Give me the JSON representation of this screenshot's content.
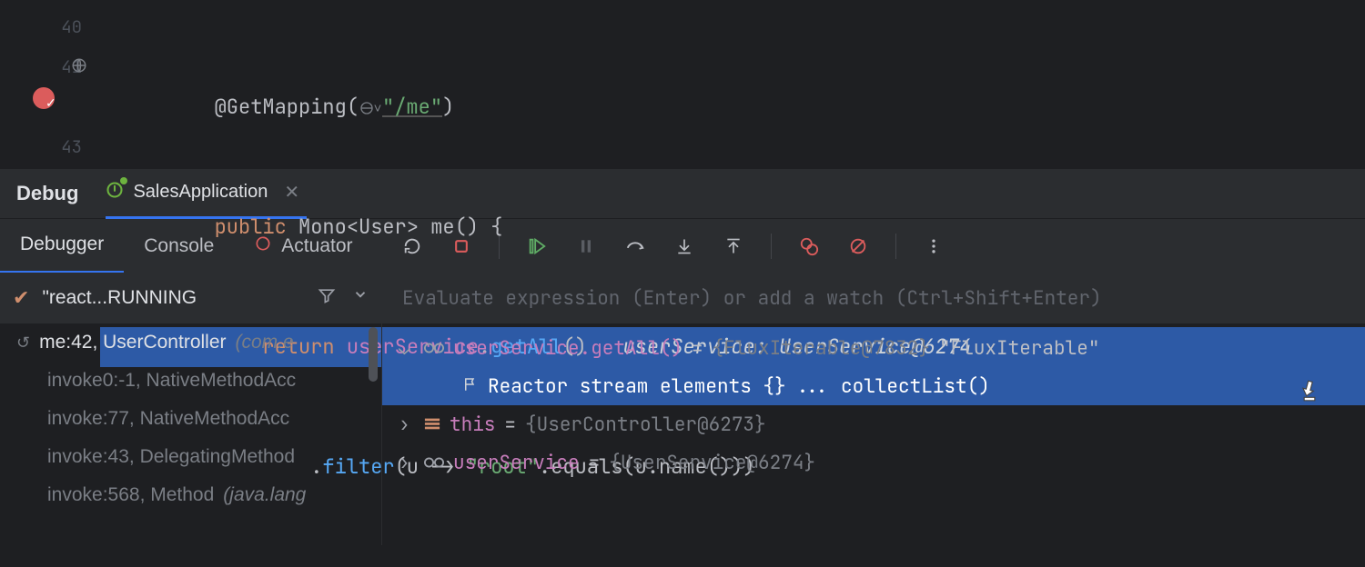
{
  "editor": {
    "lines": {
      "l40": {
        "no": "40",
        "annotation": "@GetMapping",
        "url": "\"/me\"",
        "paren_open": "(",
        "paren_close": ")"
      },
      "l41": {
        "no": "41",
        "kw_public": "public",
        "type": "Mono<User>",
        "method": "me",
        "tail": "() {"
      },
      "l42": {
        "no": "",
        "kw_return": "return",
        "ident": "userService",
        "dot": ".",
        "call": "getAll",
        "parens": "()",
        "inlay": "userService: UserService@6274"
      },
      "l43": {
        "no": "43",
        "indent": "                ",
        "dot": ".",
        "call": "filter",
        "args_pre": "(u -> ",
        "str": "\"root\"",
        "args_post": ".equals(u.name()))"
      }
    }
  },
  "debug_header": {
    "title": "Debug",
    "run_config": "SalesApplication"
  },
  "debug_tabs": {
    "debugger": "Debugger",
    "console": "Console",
    "actuator": "Actuator"
  },
  "frames": {
    "thread": "\"react...RUNNING",
    "rows": [
      {
        "undo": true,
        "main": "me:42, UserController ",
        "dim": "(com.e"
      },
      {
        "undo": false,
        "main": "invoke0:-1, NativeMethodAcc",
        "dim": ""
      },
      {
        "undo": false,
        "main": "invoke:77, NativeMethodAcc",
        "dim": ""
      },
      {
        "undo": false,
        "main": "invoke:43, DelegatingMethod",
        "dim": ""
      },
      {
        "undo": false,
        "main": "invoke:568, Method ",
        "dim": "(java.lang"
      }
    ]
  },
  "vars": {
    "eval_placeholder": "Evaluate expression (Enter) or add a watch (Ctrl+Shift+Enter)",
    "rows": [
      {
        "kind": "watch",
        "chev": "⌄",
        "name": "userService.getAll()",
        "eq": " = ",
        "obj": "{FluxIterable@7832}",
        "str": " \"FluxIterable\""
      },
      {
        "kind": "reactor",
        "indent": 1,
        "selected": true,
        "label": "Reactor stream elements {}",
        "hint": " ... collectList()"
      },
      {
        "kind": "var",
        "chev": "›",
        "icon": "field",
        "name": "this",
        "eq": " = ",
        "obj": "{UserController@6273}"
      },
      {
        "kind": "var",
        "chev": "›",
        "icon": "glasses",
        "name": "userService",
        "eq": " = ",
        "obj": "{UserService@6274}"
      }
    ]
  }
}
